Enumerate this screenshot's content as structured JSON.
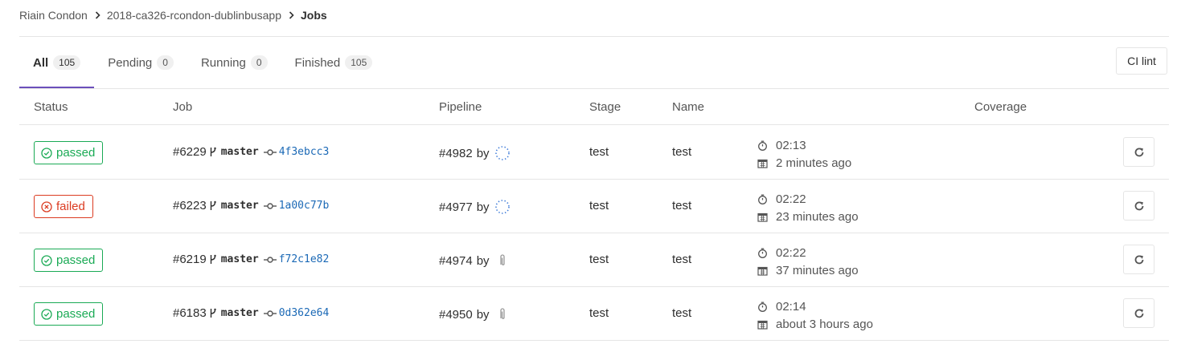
{
  "breadcrumb": {
    "items": [
      "Riain Condon",
      "2018-ca326-rcondon-dublinbusapp",
      "Jobs"
    ]
  },
  "tabs": [
    {
      "label": "All",
      "count": "105"
    },
    {
      "label": "Pending",
      "count": "0"
    },
    {
      "label": "Running",
      "count": "0"
    },
    {
      "label": "Finished",
      "count": "105"
    }
  ],
  "ci_lint_label": "CI lint",
  "table": {
    "headers": {
      "status": "Status",
      "job": "Job",
      "pipeline": "Pipeline",
      "stage": "Stage",
      "name": "Name",
      "coverage": "Coverage"
    },
    "rows": [
      {
        "status": "passed",
        "job": "#6229",
        "ref": "master",
        "sha": "4f3ebcc3",
        "pipeline": "#4982",
        "by": "by",
        "stage": "test",
        "name": "test",
        "duration": "02:13",
        "finished": "2 minutes ago"
      },
      {
        "status": "failed",
        "job": "#6223",
        "ref": "master",
        "sha": "1a00c77b",
        "pipeline": "#4977",
        "by": "by",
        "stage": "test",
        "name": "test",
        "duration": "02:22",
        "finished": "23 minutes ago"
      },
      {
        "status": "passed",
        "job": "#6219",
        "ref": "master",
        "sha": "f72c1e82",
        "pipeline": "#4974",
        "by": "by",
        "stage": "test",
        "name": "test",
        "duration": "02:22",
        "finished": "37 minutes ago"
      },
      {
        "status": "passed",
        "job": "#6183",
        "ref": "master",
        "sha": "0d362e64",
        "pipeline": "#4950",
        "by": "by",
        "stage": "test",
        "name": "test",
        "duration": "02:14",
        "finished": "about 3 hours ago"
      }
    ]
  },
  "colors": {
    "passed": "#1aaa55",
    "failed": "#db3b21",
    "tab_active": "#6b4fbb",
    "link": "#1b69b6"
  },
  "icons": {
    "breadcrumb_separator": "chevron-right-icon",
    "status_passed": "status-success-icon",
    "status_failed": "status-failed-icon",
    "branch": "branch-icon",
    "commit": "commit-icon",
    "duration": "timer-icon",
    "finished": "calendar-icon",
    "retry": "retry-icon"
  }
}
